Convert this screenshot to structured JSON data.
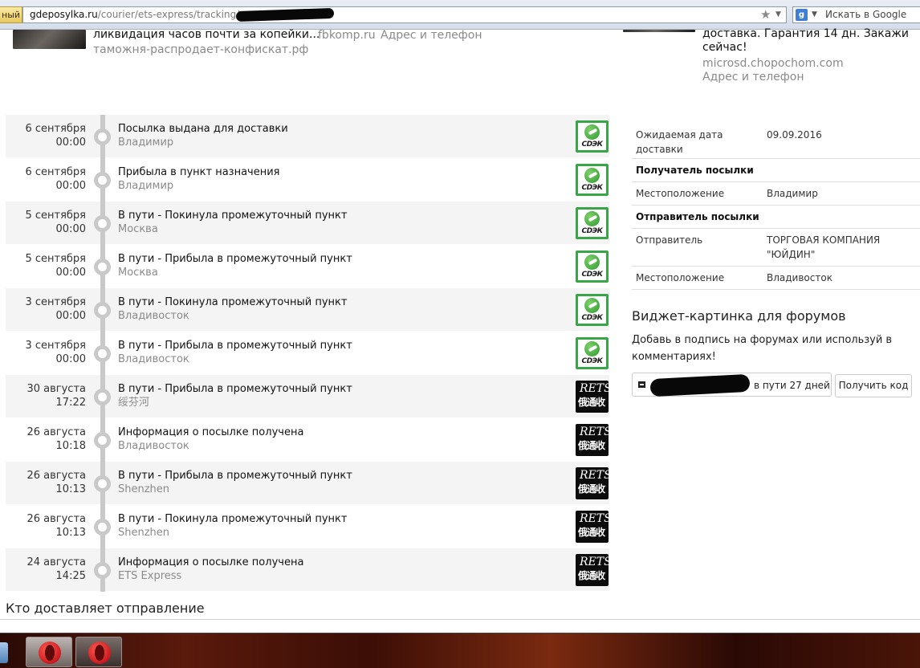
{
  "browser": {
    "site_badge": "ный",
    "url_domain": "gdeposylka.ru",
    "url_path": "/courier/ets-express/tracking/",
    "search_placeholder": "Искать в Google"
  },
  "ads": {
    "left": {
      "title": "ликвидация часов почти за копейки...",
      "domain": "таможня-распродает-конфискат.рф",
      "middle_domain": "fbkomp.ru",
      "middle_link": "Адрес и телефон"
    },
    "right": {
      "line1": "доставка. Гарантия 14 дн. Закажи",
      "line2": "сейчас!",
      "domain": "microsd.chopochom.com",
      "link": "Адрес и телефон"
    }
  },
  "events": [
    {
      "date": "6 сентября",
      "time": "00:00",
      "status": "Посылка выдана для доставки",
      "location": "Владимир",
      "carrier": "cdek"
    },
    {
      "date": "6 сентября",
      "time": "00:00",
      "status": "Прибыла в пункт назначения",
      "location": "Владимир",
      "carrier": "cdek"
    },
    {
      "date": "5 сентября",
      "time": "00:00",
      "status": "В пути - Покинула промежуточный пункт",
      "location": "Москва",
      "carrier": "cdek"
    },
    {
      "date": "5 сентября",
      "time": "00:00",
      "status": "В пути - Прибыла в промежуточный пункт",
      "location": "Москва",
      "carrier": "cdek"
    },
    {
      "date": "3 сентября",
      "time": "00:00",
      "status": "В пути - Покинула промежуточный пункт",
      "location": "Владивосток",
      "carrier": "cdek"
    },
    {
      "date": "3 сентября",
      "time": "00:00",
      "status": "В пути - Прибыла в промежуточный пункт",
      "location": "Владивосток",
      "carrier": "cdek"
    },
    {
      "date": "30 августа",
      "time": "17:22",
      "status": "В пути - Прибыла в промежуточный пункт",
      "location": "绥芬河",
      "carrier": "ets"
    },
    {
      "date": "26 августа",
      "time": "10:18",
      "status": "Информация о посылке получена",
      "location": "Владивосток",
      "carrier": "ets"
    },
    {
      "date": "26 августа",
      "time": "10:13",
      "status": "В пути - Прибыла в промежуточный пункт",
      "location": "Shenzhen",
      "carrier": "ets"
    },
    {
      "date": "26 августа",
      "time": "10:13",
      "status": "В пути - Покинула промежуточный пункт",
      "location": "Shenzhen",
      "carrier": "ets"
    },
    {
      "date": "24 августа",
      "time": "14:25",
      "status": "Информация о посылке получена",
      "location": "ETS Express",
      "carrier": "ets"
    }
  ],
  "logos": {
    "cdek_text": "СDЭК",
    "ets_line1": "RETS",
    "ets_line2": "俄通收"
  },
  "info": {
    "expected_label": "Ожидаемая дата доставки",
    "expected_value": "09.09.2016",
    "recipient_heading": "Получатель посылки",
    "recipient_location_label": "Местоположение",
    "recipient_location_value": "Владимир",
    "sender_heading": "Отправитель посылки",
    "sender_label": "Отправитель",
    "sender_value": "ТОРГОВАЯ КОМПАНИЯ \"ЮЙДИН\"",
    "sender_location_label": "Местоположение",
    "sender_location_value": "Владивосток"
  },
  "widget": {
    "title": "Виджет-картинка для форумов",
    "description": "Добавь в подпись на форумах или используй в комментариях!",
    "badge_text": "в пути 27 дней",
    "get_code_label": "Получить код"
  },
  "who_delivers": "Кто доставляет отправление"
}
